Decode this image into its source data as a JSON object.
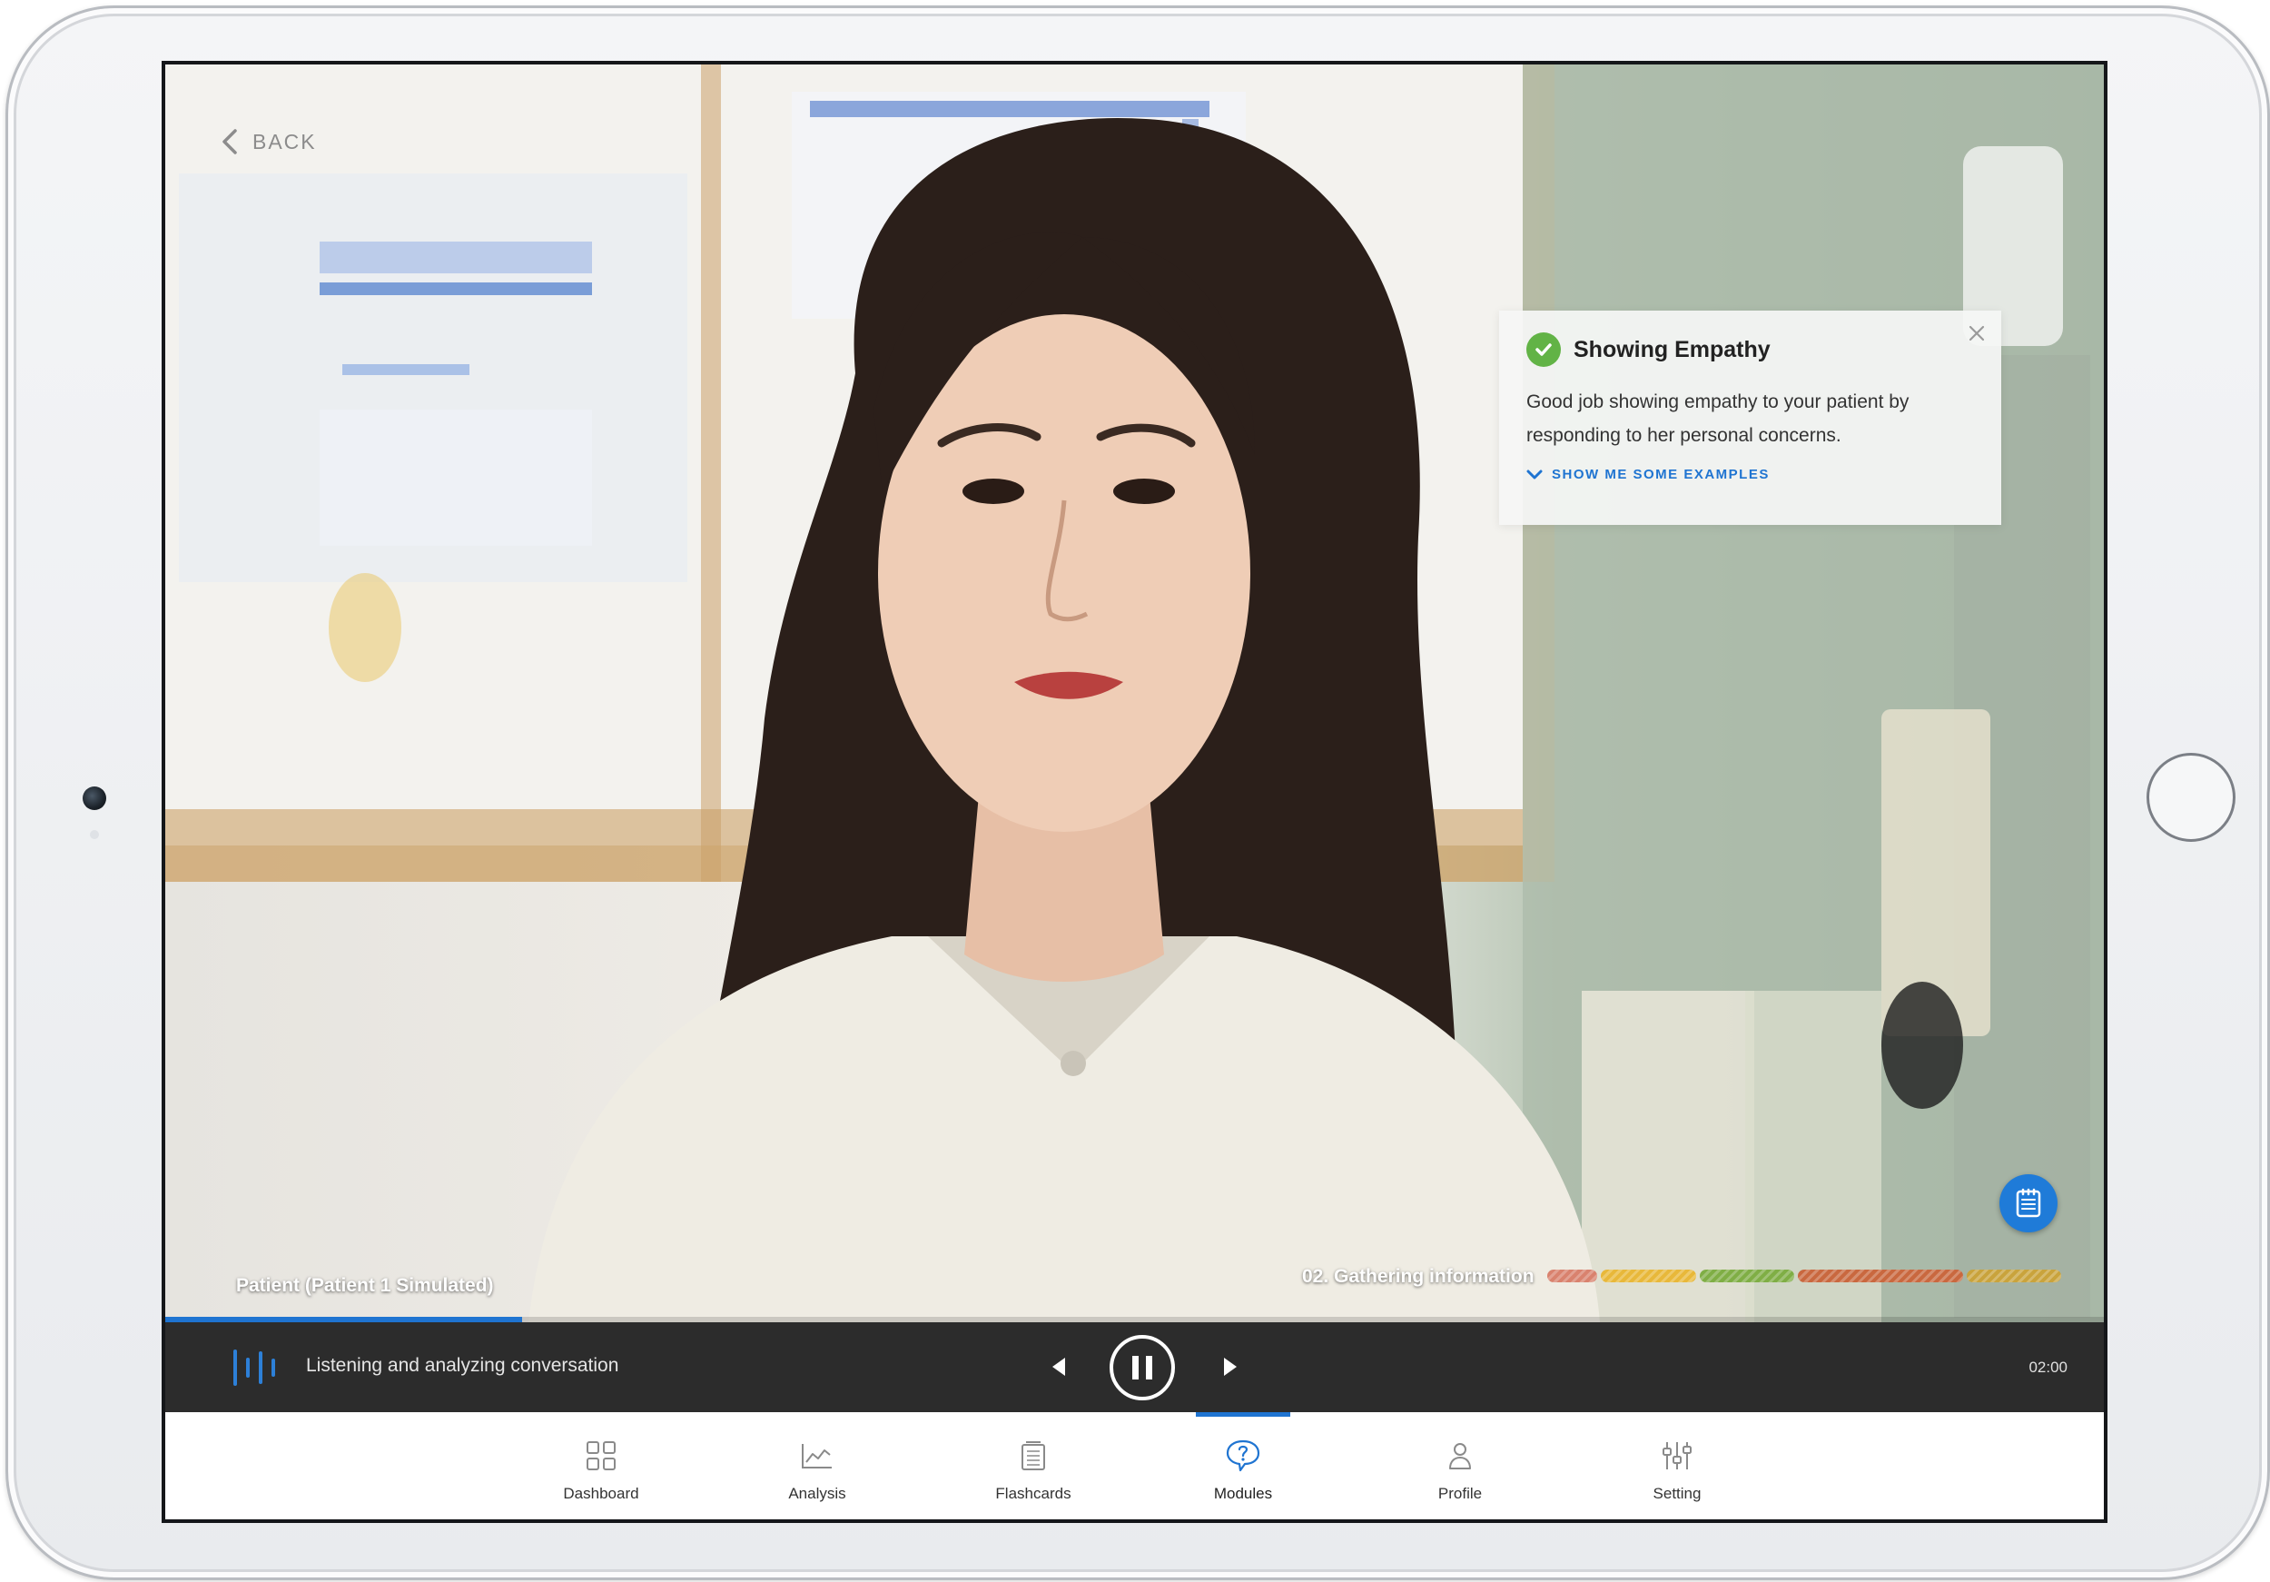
{
  "video": {
    "back_label": "BACK",
    "patient_label": "Patient (Patient 1 Simulated)",
    "section_label": "02. Gathering information",
    "progress": 0.184
  },
  "feedback_card": {
    "title": "Showing Empathy",
    "body": "Good job showing empathy to your patient by responding to her personal concerns.",
    "link": "SHOW ME SOME EXAMPLES"
  },
  "timeline_segments": [
    {
      "color": "#d9826e",
      "weight": 1.0
    },
    {
      "color": "#e8b83a",
      "weight": 1.9
    },
    {
      "color": "#7fae45",
      "weight": 1.9
    },
    {
      "color": "#c9683f",
      "weight": 3.3
    },
    {
      "color": "#c9a33c",
      "weight": 1.9
    }
  ],
  "controls": {
    "status": "Listening and analyzing conversation",
    "time": "02:00"
  },
  "nav": [
    {
      "label": "Dashboard",
      "icon": "dashboard-grid-icon",
      "active": false
    },
    {
      "label": "Analysis",
      "icon": "analysis-chart-icon",
      "active": false
    },
    {
      "label": "Flashcards",
      "icon": "flashcards-icon",
      "active": false
    },
    {
      "label": "Modules",
      "icon": "modules-chat-icon",
      "active": true
    },
    {
      "label": "Profile",
      "icon": "profile-person-icon",
      "active": false
    },
    {
      "label": "Setting",
      "icon": "settings-sliders-icon",
      "active": false
    }
  ],
  "colors": {
    "accent": "#1f74d1",
    "success": "#62b346",
    "control_bar": "#2c2c2c"
  }
}
